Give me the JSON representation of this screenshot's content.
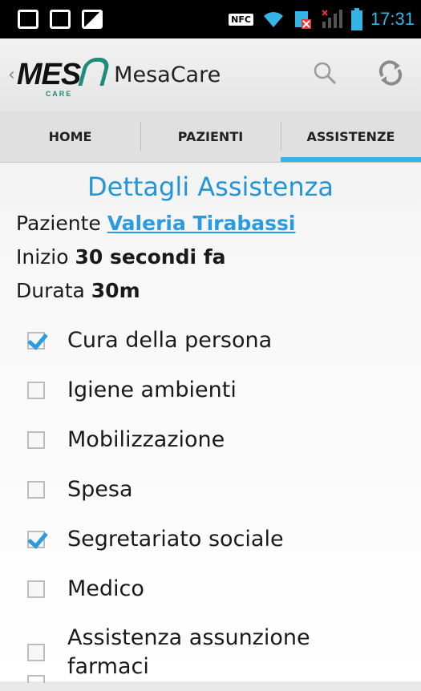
{
  "status_bar": {
    "nfc_label": "NFC",
    "time": "17:31",
    "accent": "#35b5e5"
  },
  "action_bar": {
    "logo_text": "MES",
    "logo_sub": "CARE",
    "title": "MesaCare",
    "search_icon": "search-icon",
    "refresh_icon": "refresh-icon"
  },
  "tabs": [
    {
      "label": "HOME",
      "active": false
    },
    {
      "label": "PAZIENTI",
      "active": false
    },
    {
      "label": "ASSISTENZE",
      "active": true
    }
  ],
  "details": {
    "heading": "Dettagli Assistenza",
    "patient_label": "Paziente",
    "patient_name": "Valeria Tirabassi",
    "start_label": "Inizio",
    "start_value": "30 secondi fa",
    "duration_label": "Durata",
    "duration_value": "30m"
  },
  "activities": [
    {
      "label": "Cura della persona",
      "checked": true
    },
    {
      "label": "Igiene ambienti",
      "checked": false
    },
    {
      "label": "Mobilizzazione",
      "checked": false
    },
    {
      "label": "Spesa",
      "checked": false
    },
    {
      "label": "Segretariato sociale",
      "checked": true
    },
    {
      "label": "Medico",
      "checked": false
    },
    {
      "label": "Assistenza assunzione farmaci",
      "checked": false
    }
  ],
  "colors": {
    "accent_blue": "#2a9be0",
    "heading_blue": "#2196d9",
    "logo_green": "#1e8c7a"
  }
}
